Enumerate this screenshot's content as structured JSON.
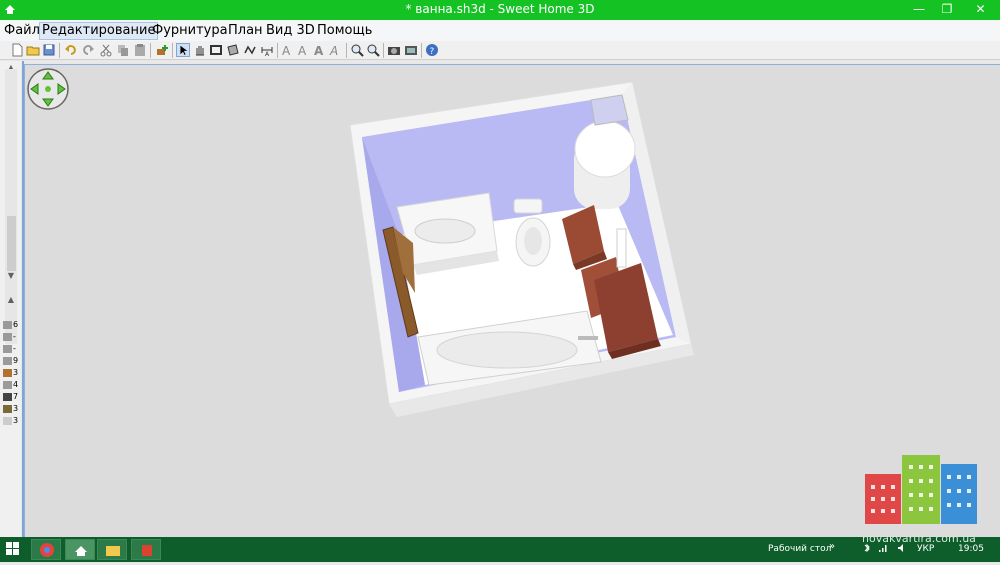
{
  "window": {
    "title": "* ванна.sh3d - Sweet Home 3D",
    "minimize_glyph": "—",
    "maximize_glyph": "❐",
    "close_glyph": "✕"
  },
  "menu": {
    "items": [
      {
        "label": "Файл"
      },
      {
        "label": "Редактирование"
      },
      {
        "label": "Фурнитура"
      },
      {
        "label": "План"
      },
      {
        "label": "Вид 3D"
      },
      {
        "label": "Помощь"
      }
    ],
    "active_index": 1
  },
  "toolbar": {
    "icons": [
      "new-file-icon",
      "open-file-icon",
      "save-file-icon",
      "undo-icon",
      "redo-icon",
      "cut-icon",
      "copy-icon",
      "paste-icon",
      "add-furniture-icon",
      "select-mode-icon",
      "pan-mode-icon",
      "create-walls-icon",
      "create-rooms-icon",
      "create-polylines-icon",
      "create-dimensions-icon",
      "create-labels-icon",
      "text-style-icon",
      "text-size-icon",
      "text-bold-icon",
      "text-italic-icon",
      "zoom-in-icon",
      "zoom-out-icon",
      "create-photo-icon",
      "create-video-icon",
      "help-icon"
    ]
  },
  "furniture_list": {
    "counts": [
      "6",
      "-",
      "-",
      "9",
      "3",
      "4",
      "7",
      "3",
      "3"
    ]
  },
  "taskbar": {
    "desktop_label": "Рабочий стол",
    "chevron": "»",
    "language": "УКР",
    "time": "19:05",
    "watermark": "novakvartira.com.ua"
  },
  "colors": {
    "title_bar": "#15c224",
    "taskbar": "#0e5e2c",
    "view_background": "#dcdcdc",
    "wall_color": "#b4b4f4",
    "floor_color": "#ffffff"
  }
}
